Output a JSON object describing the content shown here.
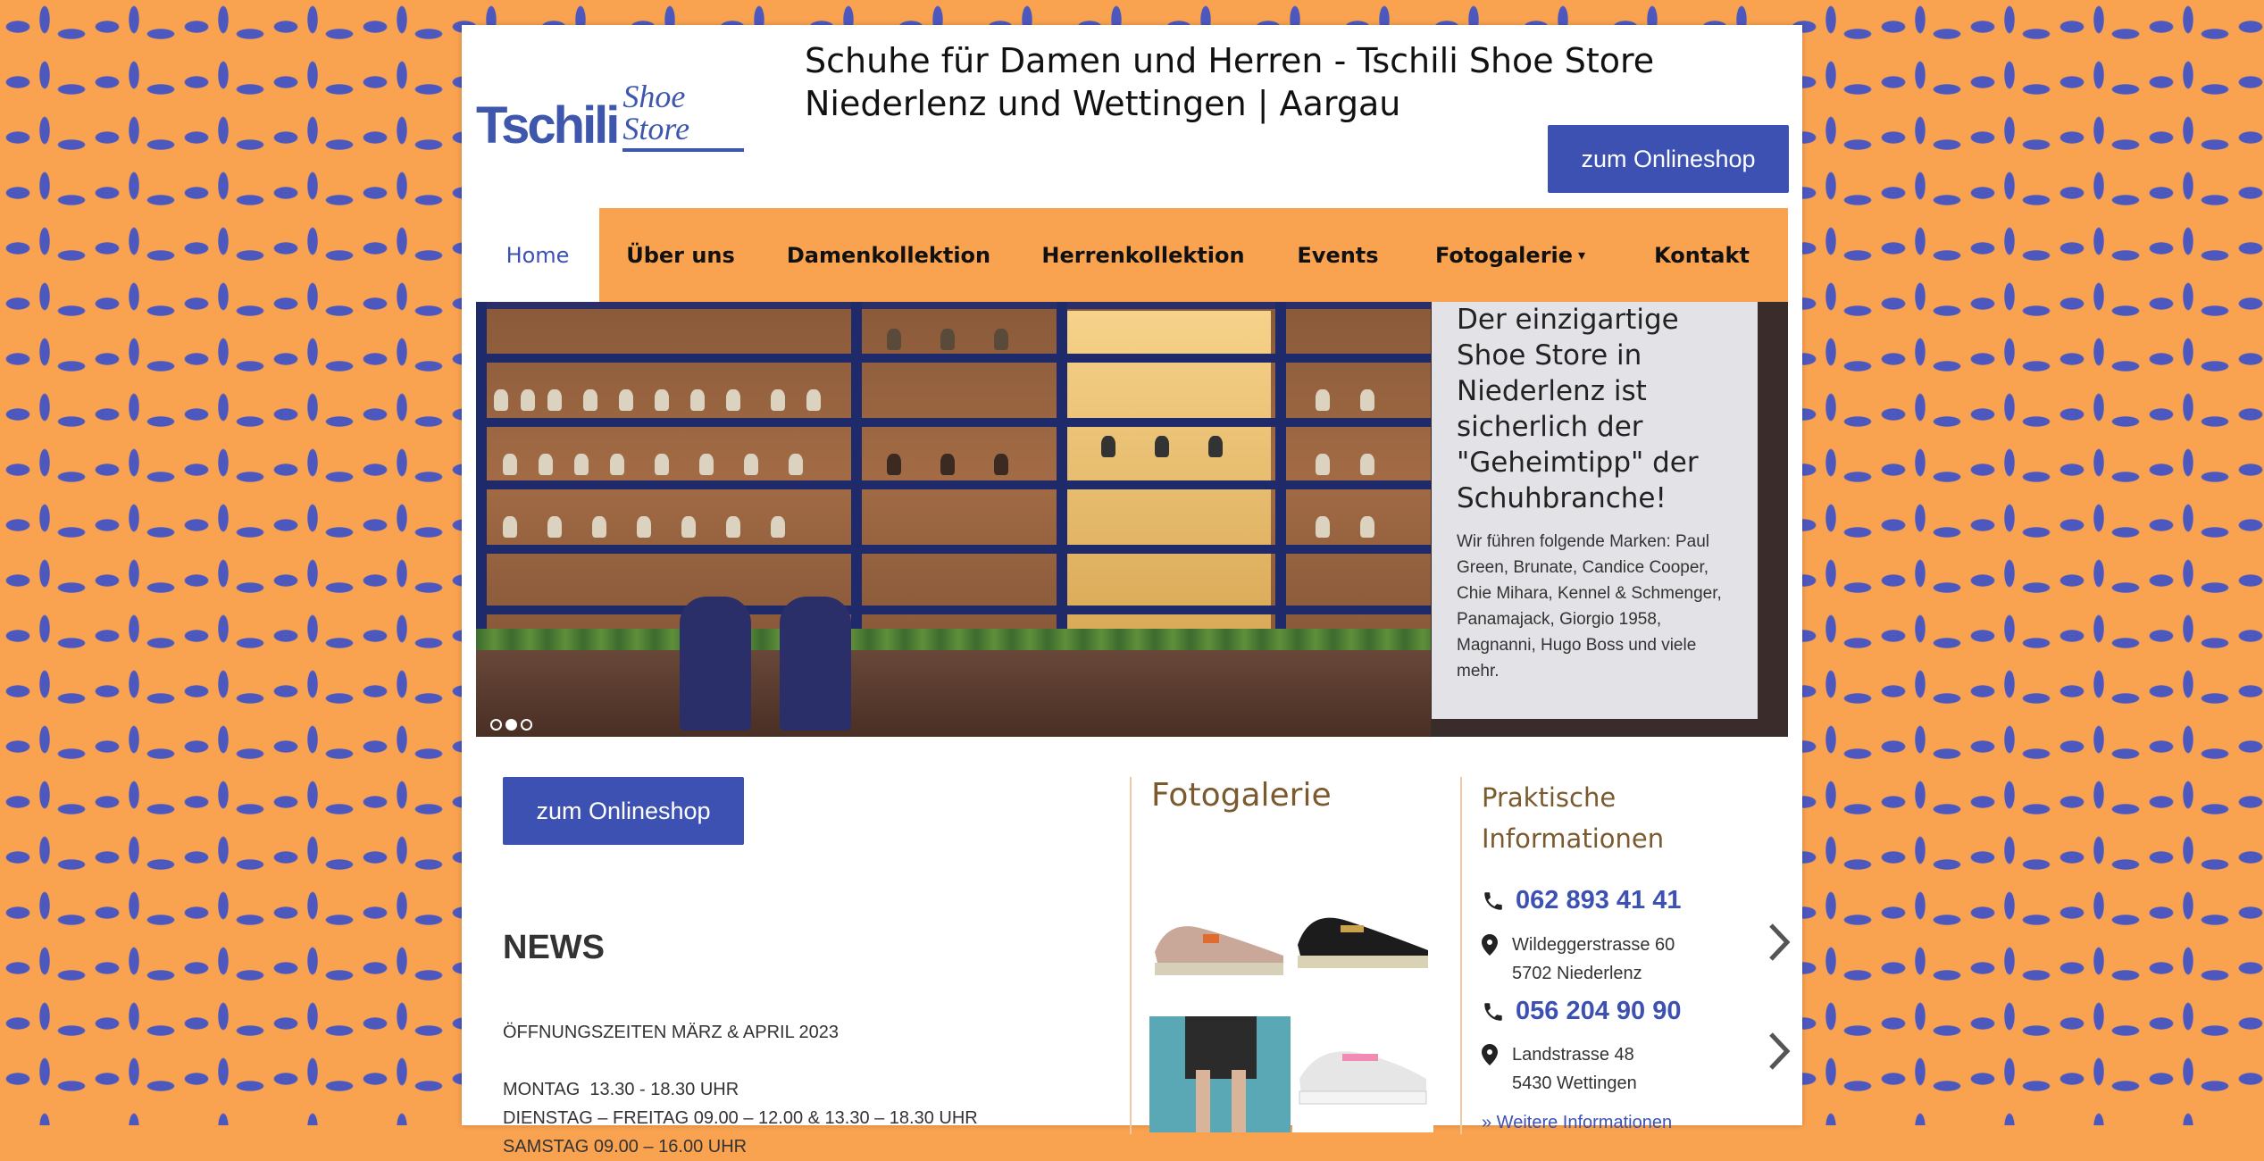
{
  "brand": {
    "logo_main": "Tschili",
    "logo_sub": "Shoe Store",
    "color_primary": "#3d51b3",
    "color_accent": "#f9a350"
  },
  "header": {
    "title": "Schuhe für Damen und Herren - Tschili Shoe Store Niederlenz und Wettingen | Aargau",
    "onlineshop_label": "zum Onlineshop"
  },
  "nav": {
    "items": [
      {
        "label": "Home",
        "active": true
      },
      {
        "label": "Über uns"
      },
      {
        "label": "Damenkollektion"
      },
      {
        "label": "Herrenkollektion"
      },
      {
        "label": "Events"
      },
      {
        "label": "Fotogalerie",
        "icon": "chevron-down-icon"
      },
      {
        "label": "Kontakt"
      }
    ]
  },
  "hero": {
    "heading": "Der einzigartige Shoe Store in Niederlenz ist sicherlich der \"Geheimtipp\" der Schuhbranche!",
    "body": "Wir führen folgende Marken: Paul Green, Brunate, Candice Cooper, Chie Mihara, Kennel & Schmenger, Panamajack, Giorgio 1958, Magnanni, Hugo Boss und viele mehr.",
    "slide_count": 3,
    "active_slide": 2
  },
  "main": {
    "onlineshop_label": "zum Onlineshop",
    "news_title": "NEWS",
    "news_lines": [
      "ÖFFNUNGSZEITEN MÄRZ & APRIL 2023",
      "",
      "MONTAG  13.30 - 18.30 UHR",
      "DIENSTAG – FREITAG 09.00 – 12.00 & 13.30 – 18.30 UHR",
      "SAMSTAG 09.00 – 16.00 UHR"
    ]
  },
  "gallery": {
    "title": "Fotogalerie"
  },
  "info": {
    "title": "Praktische Informationen",
    "locations": [
      {
        "phone": "062 893 41 41",
        "street": "Wildeggerstrasse 60",
        "city": "5702 Niederlenz"
      },
      {
        "phone": "056 204 90 90",
        "street": "Landstrasse 48",
        "city": "5430 Wettingen"
      }
    ],
    "more_link": "» Weitere Informationen"
  }
}
